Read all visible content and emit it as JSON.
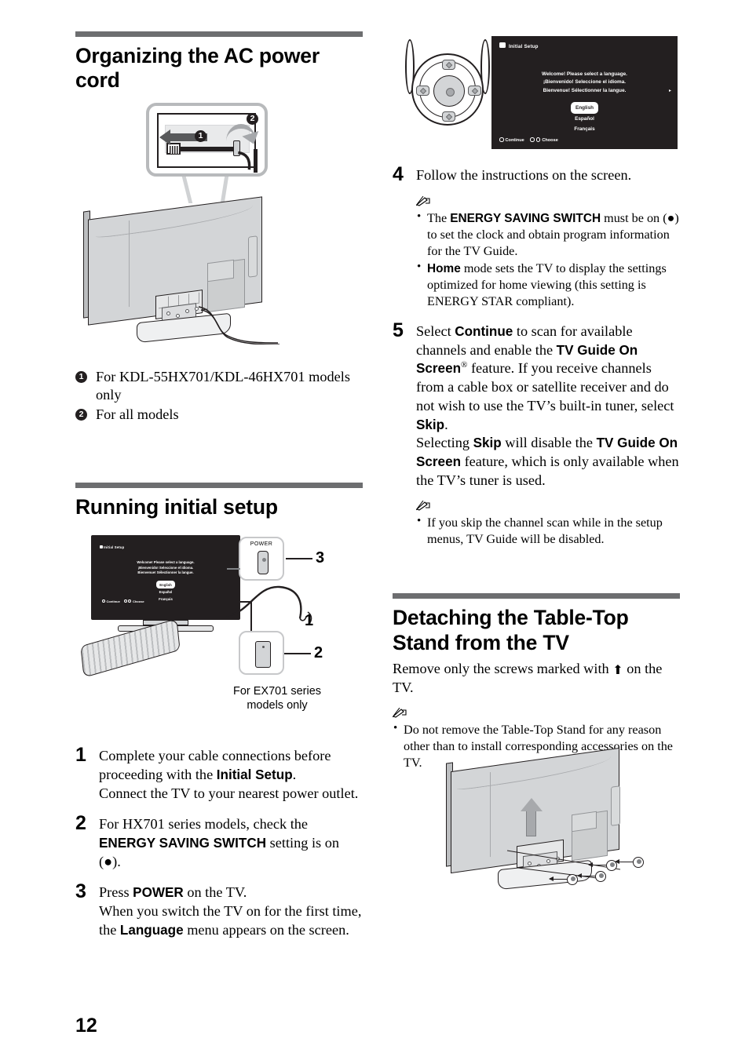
{
  "page": {
    "number": "12"
  },
  "sections": {
    "ac_power": {
      "title": "Organizing the AC power cord",
      "figure": {
        "callout_1": "1",
        "callout_2": "2"
      },
      "captions": [
        {
          "marker": "1",
          "text": "For KDL-55HX701/KDL-46HX701 models only"
        },
        {
          "marker": "2",
          "text": "For all models"
        }
      ]
    },
    "initial_setup": {
      "title": "Running initial setup",
      "figure": {
        "power_label": "POWER",
        "tag_1": "1",
        "tag_2": "2",
        "tag_3": "3",
        "caption": "For EX701 series models only"
      },
      "steps": [
        {
          "num": "1",
          "lines": [
            {
              "runs": [
                {
                  "t": "Complete your cable connections before proceeding with the "
                },
                {
                  "t": "Initial Setup",
                  "bold": true
                },
                {
                  "t": "."
                }
              ]
            },
            {
              "runs": [
                {
                  "t": "Connect the TV to your nearest power outlet."
                }
              ]
            }
          ]
        },
        {
          "num": "2",
          "lines": [
            {
              "runs": [
                {
                  "t": "For HX701 series models, check the "
                },
                {
                  "t": "ENERGY SAVING SWITCH",
                  "bold": true
                },
                {
                  "t": " setting is on (●)."
                }
              ]
            }
          ]
        },
        {
          "num": "3",
          "lines": [
            {
              "runs": [
                {
                  "t": "Press "
                },
                {
                  "t": "POWER",
                  "bold": true
                },
                {
                  "t": " on the TV."
                }
              ]
            },
            {
              "runs": [
                {
                  "t": "When you switch the TV on for the first time, the "
                },
                {
                  "t": "Language",
                  "bold": true
                },
                {
                  "t": " menu appears on the screen."
                }
              ]
            }
          ]
        },
        {
          "num": "4",
          "lines": [
            {
              "runs": [
                {
                  "t": "Follow the instructions on the screen."
                }
              ]
            }
          ],
          "notes": [
            {
              "runs": [
                {
                  "t": "The "
                },
                {
                  "t": "ENERGY SAVING SWITCH",
                  "bold": true
                },
                {
                  "t": " must be on (●) to set the clock and obtain program information for the TV Guide."
                }
              ]
            },
            {
              "runs": [
                {
                  "t": "Home",
                  "bold": true
                },
                {
                  "t": " mode sets the TV to display the settings optimized for home viewing (this setting is ENERGY STAR compliant)."
                }
              ]
            }
          ]
        },
        {
          "num": "5",
          "lines": [
            {
              "runs": [
                {
                  "t": "Select "
                },
                {
                  "t": "Continue",
                  "bold": true
                },
                {
                  "t": " to scan for available channels and enable the "
                },
                {
                  "t": "TV Guide On Screen",
                  "bold": true
                },
                {
                  "t": "®",
                  "sup": true
                },
                {
                  "t": " feature. If you receive channels from a cable box or satellite receiver and do not wish to use the TV’s built-in tuner, select "
                },
                {
                  "t": "Skip",
                  "bold": true
                },
                {
                  "t": "."
                }
              ]
            },
            {
              "runs": [
                {
                  "t": "Selecting "
                },
                {
                  "t": "Skip",
                  "bold": true
                },
                {
                  "t": " will disable the "
                },
                {
                  "t": "TV Guide On Screen",
                  "bold": true
                },
                {
                  "t": " feature, which is only available when the TV’s tuner is used."
                }
              ]
            }
          ],
          "notes": [
            {
              "runs": [
                {
                  "t": "If you skip the channel scan while in the setup menus, TV Guide will be disabled."
                }
              ]
            }
          ]
        }
      ]
    },
    "detaching": {
      "title": "Detaching the Table-Top Stand from the TV",
      "body_before": "Remove only the screws marked with ",
      "body_symbol": "⬆",
      "body_after": " on the TV.",
      "notes": [
        {
          "runs": [
            {
              "t": "Do not remove the Table-Top Stand for any reason other than to install corresponding accessories on the TV."
            }
          ]
        }
      ]
    }
  },
  "osd": {
    "title": "Initial Setup",
    "welcome": [
      "Welcome! Please select a language.",
      "¡Bienvenido! Seleccione el idioma.",
      "Bienvenue! Sélectionner la langue."
    ],
    "languages": [
      {
        "label": "English",
        "selected": true
      },
      {
        "label": "Español",
        "selected": false
      },
      {
        "label": "Français",
        "selected": false
      }
    ],
    "footer_continue": "Continue",
    "footer_choose": "Choose"
  },
  "colors": {
    "rule": "#6d6e70",
    "osd_background": "#231f20",
    "tv_body": "#d3d5d7",
    "text": "#000000"
  },
  "icons": {
    "note": "✎",
    "bullet": "•"
  }
}
